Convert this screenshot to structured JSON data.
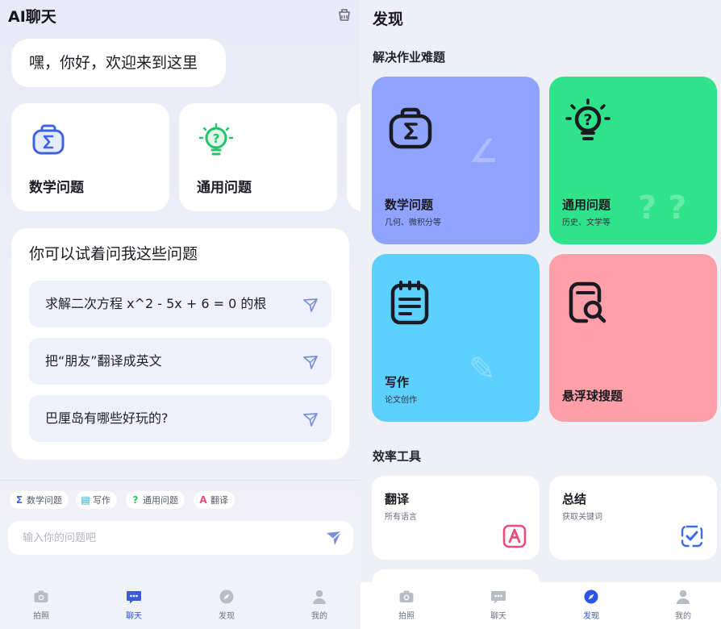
{
  "left": {
    "app_title": "AI聊天",
    "greeting": "嘿，你好，欢迎来到这里",
    "categories": [
      {
        "label": "数学问题",
        "icon": "math-sigma-icon"
      },
      {
        "label": "通用问题",
        "icon": "lightbulb-question-icon"
      }
    ],
    "suggestions_title": "你可以试着问我这些问题",
    "suggestions": [
      "求解二次方程 x^2 - 5x + 6 = 0 的根",
      "把“朋友”翻译成英文",
      "巴厘岛有哪些好玩的?"
    ],
    "chips": [
      {
        "icon_char": "Σ",
        "label": "数学问题"
      },
      {
        "icon_char": "▤",
        "label": "写作"
      },
      {
        "icon_char": "?",
        "label": "通用问题"
      },
      {
        "icon_char": "A",
        "label": "翻译"
      }
    ],
    "input_placeholder": "输入你的问题吧",
    "tabs": [
      {
        "label": "拍照",
        "icon": "camera-icon"
      },
      {
        "label": "聊天",
        "icon": "chat-icon"
      },
      {
        "label": "发现",
        "icon": "compass-icon"
      },
      {
        "label": "我的",
        "icon": "user-icon"
      }
    ],
    "active_tab": "聊天"
  },
  "right": {
    "page_title": "发现",
    "section1_title": "解决作业难题",
    "cards": [
      {
        "title": "数学问题",
        "subtitle": "几何、微积分等",
        "color": "#8fa3ff",
        "icon": "math-sigma-icon"
      },
      {
        "title": "通用问题",
        "subtitle": "历史、文学等",
        "color": "#2ee38a",
        "icon": "lightbulb-question-icon"
      },
      {
        "title": "写作",
        "subtitle": "论文创作",
        "color": "#5cd0ff",
        "icon": "notepad-icon"
      },
      {
        "title": "悬浮球搜题",
        "subtitle": "",
        "color": "#ff9fa8",
        "icon": "search-doc-icon"
      }
    ],
    "section2_title": "效率工具",
    "tools": [
      {
        "title": "翻译",
        "subtitle": "所有语言",
        "icon": "translate-icon"
      },
      {
        "title": "总结",
        "subtitle": "获取关键词",
        "icon": "summary-check-icon"
      }
    ],
    "tabs": [
      {
        "label": "拍照",
        "icon": "camera-icon"
      },
      {
        "label": "聊天",
        "icon": "chat-icon"
      },
      {
        "label": "发现",
        "icon": "compass-icon"
      },
      {
        "label": "我的",
        "icon": "user-icon"
      }
    ],
    "active_tab": "发现"
  },
  "colors": {
    "accent": "#2f55e6",
    "chat_icon_blue": "#3b5bdb",
    "send_arrow": "#7b8fd6",
    "translate_pink": "#e94d7c",
    "summary_blue": "#3d6be0"
  }
}
